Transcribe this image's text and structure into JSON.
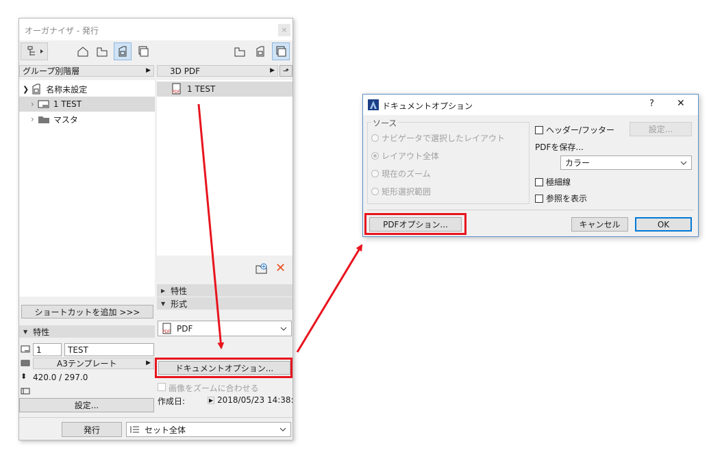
{
  "organizer": {
    "title": "オーガナイザ - 発行",
    "close_glyph": "×",
    "left_dropdown": "グループ別階層",
    "tree": [
      {
        "label": "名称未設定"
      },
      {
        "label": "1 TEST"
      },
      {
        "label": "マスタ"
      }
    ],
    "right_dropdown": "3D PDF",
    "publish_items": [
      {
        "label": "1 TEST"
      }
    ],
    "add_shortcut_label": "ショートカットを追加 >>>",
    "properties_header": "特性",
    "property_number": "1",
    "property_name": "TEST",
    "template": "A3テンプレート",
    "size": "420.0 / 297.0",
    "settings_label": "設定...",
    "section_properties": "特性",
    "section_format": "形式",
    "format_value": "PDF",
    "document_options_label": "ドキュメントオプション...",
    "fit_zoom_label": "画像をズームに合わせる",
    "created_label": "作成日:",
    "created_value": "2018/05/23 14:38:",
    "publish_label": "発行",
    "set_dropdown": "セット全体"
  },
  "dialog": {
    "title": "ドキュメントオプション",
    "help_glyph": "?",
    "close_glyph": "✕",
    "source_group": "ソース",
    "source_options": [
      {
        "label": "ナビゲータで選択したレイアウト",
        "selected": false
      },
      {
        "label": "レイアウト全体",
        "selected": true
      },
      {
        "label": "現在のズーム",
        "selected": false
      },
      {
        "label": "矩形選択範囲",
        "selected": false
      }
    ],
    "header_footer_label": "ヘッダー/フッター",
    "header_settings_label": "設定...",
    "save_pdf_label": "PDFを保存...",
    "color_value": "カラー",
    "hairline_label": "極細線",
    "show_reference_label": "参照を表示",
    "pdf_options_label": "PDFオプション...",
    "cancel_label": "キャンセル",
    "ok_label": "OK"
  },
  "colors": {
    "highlight_red": "#e8141e",
    "selected_blue": "#cfe3f5",
    "dialog_border": "#5b8fc7"
  }
}
